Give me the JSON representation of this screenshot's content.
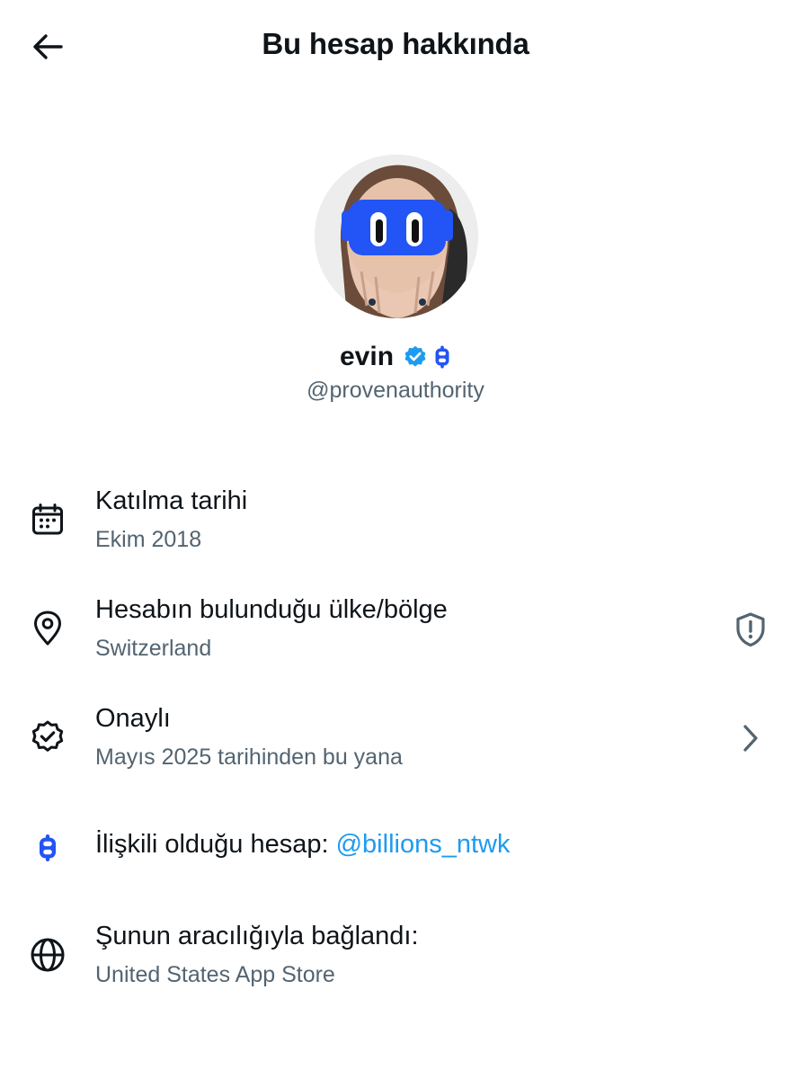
{
  "header": {
    "title": "Bu hesap hakkında",
    "back_icon": "arrow-left-icon"
  },
  "profile": {
    "display_name": "evin",
    "handle": "@provenauthority",
    "verified_icon": "verified-badge-icon",
    "affiliate_icon": "billions-logo-icon",
    "verified_color": "#1d9bf0",
    "affiliate_color": "#2354f5"
  },
  "rows": {
    "joined": {
      "icon": "calendar-icon",
      "title": "Katılma tarihi",
      "subtitle": "Ekim 2018"
    },
    "location": {
      "icon": "location-pin-icon",
      "title": "Hesabın bulunduğu ülke/bölge",
      "subtitle": "Switzerland",
      "end_icon": "shield-alert-icon"
    },
    "verified": {
      "icon": "verified-outline-icon",
      "title": "Onaylı",
      "subtitle": "Mayıs 2025 tarihinden bu yana",
      "end_icon": "chevron-right-icon"
    },
    "affiliated": {
      "icon": "billions-logo-icon",
      "title": "İlişkili olduğu hesap: ",
      "link": "@billions_ntwk"
    },
    "connected": {
      "icon": "globe-icon",
      "title": "Şunun aracılığıyla bağlandı:",
      "subtitle": "United States App Store"
    }
  },
  "colors": {
    "text_primary": "#0f1419",
    "text_secondary": "#536471",
    "link": "#1d9bf0",
    "brand_blue": "#2354f5"
  }
}
